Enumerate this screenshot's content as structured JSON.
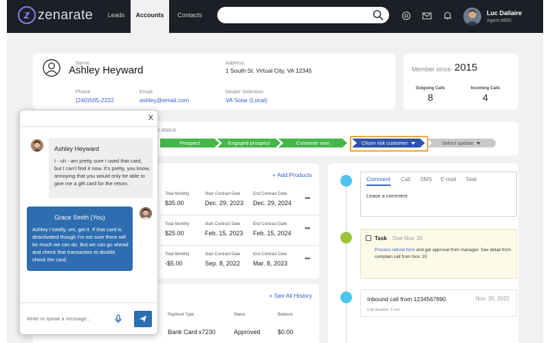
{
  "app": {
    "logo_text": "zenarate"
  },
  "nav": {
    "leads": "Leads",
    "accounts": "Accounts",
    "contacts": "Contacts"
  },
  "search": {
    "value": ""
  },
  "user": {
    "name": "Luc Dallaire",
    "id": "Agent #850"
  },
  "profile": {
    "name_label": "Name",
    "name": "Ashley Heyward",
    "address_label": "Address",
    "address": "1 South St. Virtual City, VA 12345",
    "phone_label": "Phone",
    "phone": "(240)505-2222",
    "email_label": "Email",
    "email": "ashley@email.com",
    "dealer_label": "Dealer Selection",
    "dealer": "VA Solar (Local)"
  },
  "member": {
    "since_label": "Member since:",
    "since_year": "2015",
    "outgoing_label": "Outgoing Calls",
    "outgoing": "8",
    "incoming_label": "Incoming Calls",
    "incoming": "4"
  },
  "status": {
    "label": "e status",
    "steps": [
      "Prospect",
      "Engaged prospect",
      "Customer won",
      "Churn risk customer",
      "Select update"
    ],
    "current": "Churn risk customer",
    "colors": {
      "done": "#45b649",
      "current": "#2e53a8",
      "pending": "#c9c9c9",
      "highlight": "#f0a23a"
    }
  },
  "products": {
    "add_label": "+ Add Products",
    "columns": [
      "Total Monthly",
      "Start Contract Date",
      "End Contract Date"
    ],
    "rows": [
      {
        "monthly": "$35.00",
        "start": "Dec. 29, 2023",
        "end": "Dec. 29, 2024"
      },
      {
        "monthly": "$25.00",
        "start": "Feb. 15, 2023",
        "end": "Feb. 15, 2024"
      },
      {
        "monthly": "-$5.00",
        "start": "Sep. 8, 2022",
        "end": "Mar. 8, 2023"
      }
    ],
    "more_label": "•••"
  },
  "history": {
    "see_all": "+ See All History",
    "columns": [
      "Payment Type",
      "Status",
      "Balance"
    ],
    "row": {
      "payment": "Bank Card x7230",
      "status": "Approved",
      "balance": "$0.00"
    }
  },
  "activity": {
    "tabs": [
      "Comment",
      "Call",
      "SMS",
      "E-mail",
      "Task"
    ],
    "comment_placeholder": "Leave a comment",
    "task": {
      "title": "Task",
      "due": "Due Nov. 20",
      "link": "Process refund form",
      "desc": " and get approval from manager. See detail from complain call from Nov. 20"
    },
    "call": {
      "title": "Inbound call from 1234567890",
      "date": "Nov. 20, 2022",
      "duration": "Call duration: 5 mm"
    },
    "dot_colors": [
      "#4cc4ee",
      "#9bc43a",
      "#4cc4ee"
    ]
  },
  "chat": {
    "close": "X",
    "incoming": {
      "name": "Ashley Heyward",
      "text": "I - uh - am pretty sure I used that card, but I can't find it now. It's pretty, you know, annoying that you would only be able to give me a gift card for the return."
    },
    "outgoing": {
      "name": "Grace Smith (You)",
      "text": "Ashley I totally, um, get it. If that card is deactivated though I'm not sure there will be much we can do. But we can go ahead and check that transaction to double check the card."
    },
    "input_placeholder": "Write or speak a message..."
  }
}
